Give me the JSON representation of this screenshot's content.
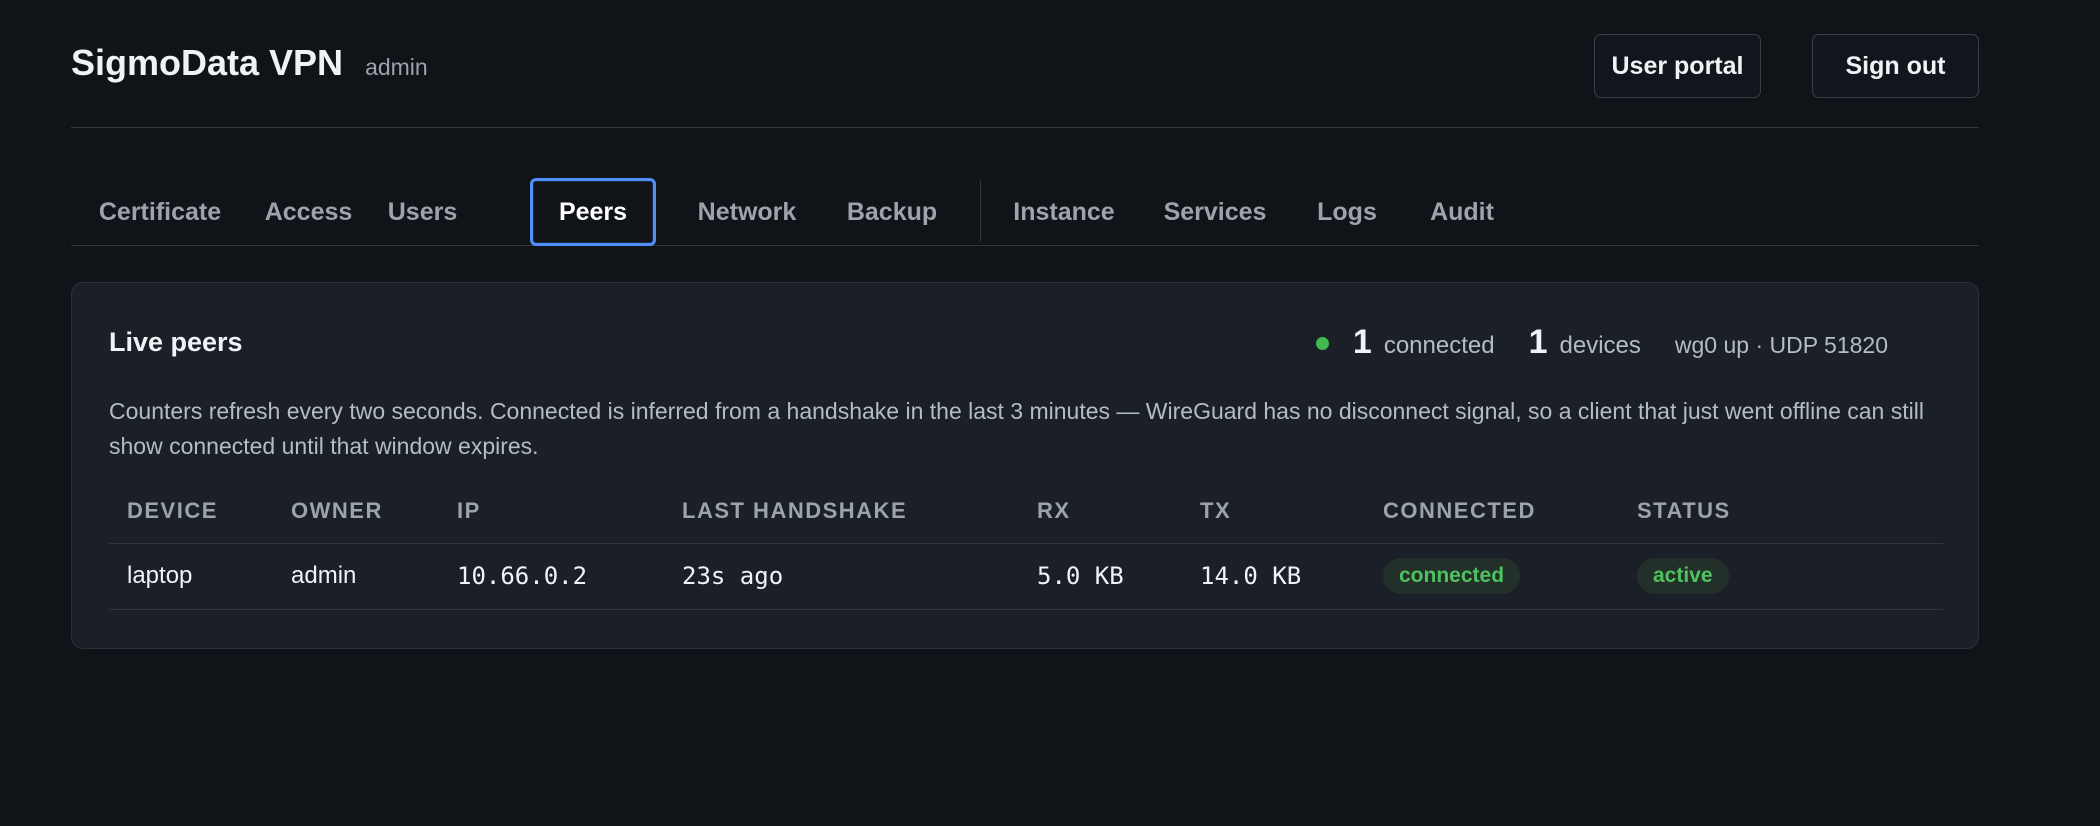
{
  "header": {
    "title": "SigmoData VPN",
    "role": "admin",
    "buttons": {
      "user_portal": "User portal",
      "sign_out": "Sign out"
    }
  },
  "tabs": [
    {
      "label": "Certificate",
      "active": false
    },
    {
      "label": "Access",
      "active": false
    },
    {
      "label": "Users",
      "active": false
    },
    {
      "label": "Peers",
      "active": true
    },
    {
      "label": "Network",
      "active": false
    },
    {
      "label": "Backup",
      "active": false
    },
    {
      "label": "Instance",
      "active": false
    },
    {
      "label": "Services",
      "active": false
    },
    {
      "label": "Logs",
      "active": false
    },
    {
      "label": "Audit",
      "active": false
    }
  ],
  "panel": {
    "title": "Live peers",
    "stats": {
      "connected_count": "1",
      "connected_label": "connected",
      "devices_count": "1",
      "devices_label": "devices",
      "interface": "wg0 up · UDP 51820"
    },
    "description": "Counters refresh every two seconds. Connected is inferred from a handshake in the last 3 minutes — WireGuard has no disconnect signal, so a client that just went offline can still show connected until that window expires.",
    "table": {
      "columns": [
        "DEVICE",
        "OWNER",
        "IP",
        "LAST HANDSHAKE",
        "RX",
        "TX",
        "CONNECTED",
        "STATUS"
      ],
      "rows": [
        {
          "device": "laptop",
          "owner": "admin",
          "ip": "10.66.0.2",
          "last_handshake": "23s ago",
          "rx": "5.0 KB",
          "tx": "14.0 KB",
          "connected": "connected",
          "status": "active"
        }
      ]
    }
  },
  "colors": {
    "background": "#101318",
    "panel": "#1b2028",
    "accent_active_tab": "#4f8ff7",
    "status_green": "#3fb950"
  }
}
